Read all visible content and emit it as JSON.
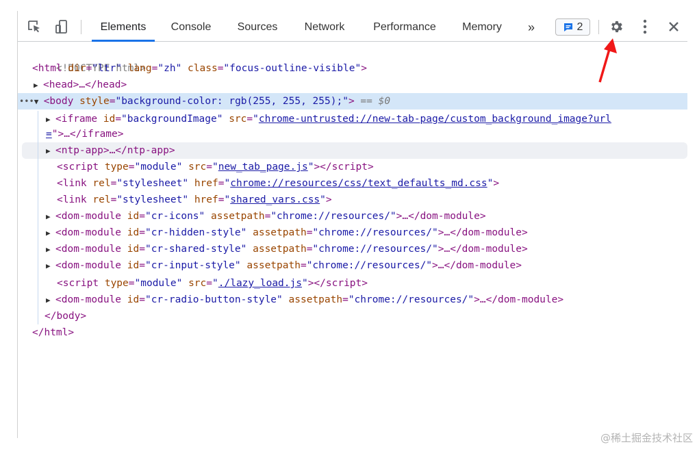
{
  "toolbar": {
    "inspect_icon": "inspect-element-icon",
    "device_icon": "device-toolbar-icon",
    "tabs": [
      {
        "label": "Elements",
        "active": true
      },
      {
        "label": "Console",
        "active": false
      },
      {
        "label": "Sources",
        "active": false
      },
      {
        "label": "Network",
        "active": false
      },
      {
        "label": "Performance",
        "active": false
      },
      {
        "label": "Memory",
        "active": false
      }
    ],
    "more_tabs": "»",
    "issues_count": "2",
    "settings_icon": "gear-icon",
    "menu_icon": "kebab-menu-icon",
    "close_icon": "close-icon"
  },
  "dom": {
    "doctype": "<!DOCTYPE html>",
    "html_open": {
      "tag": "<html",
      "attrs": [
        {
          "n": "dir",
          "v": "\"ltr\""
        },
        {
          "n": "lang",
          "v": "\"zh\""
        },
        {
          "n": "class",
          "v": "\"focus-outline-visible\""
        }
      ]
    },
    "head": "<head>…</head>",
    "body_open": {
      "tag": "<body",
      "attr": "style",
      "val": "\"background-color: rgb(255, 255, 255);\"",
      "eq": "== $0"
    },
    "iframe": {
      "tag": "<iframe",
      "id_attr": "id",
      "id_val": "\"backgroundImage\"",
      "src_attr": "src",
      "src_link_1": "chrome-untrusted://new-tab-page/custom_background_image?url",
      "src_link_2": "=",
      "tail": "\">…</iframe>"
    },
    "ntp_app": "<ntp-app>…</ntp-app>",
    "script1": {
      "type_val": "\"module\"",
      "src_link": "new_tab_page.js"
    },
    "link1": {
      "rel_val": "\"stylesheet\"",
      "href_link": "chrome://resources/css/text_defaults_md.css"
    },
    "link2": {
      "rel_val": "\"stylesheet\"",
      "href_link": "shared_vars.css"
    },
    "dom_modules": [
      {
        "id": "\"cr-icons\"",
        "path": "\"chrome://resources/\""
      },
      {
        "id": "\"cr-hidden-style\"",
        "path": "\"chrome://resources/\""
      },
      {
        "id": "\"cr-shared-style\"",
        "path": "\"chrome://resources/\""
      },
      {
        "id": "\"cr-input-style\"",
        "path": "\"chrome://resources/\""
      }
    ],
    "script2": {
      "type_val": "\"module\"",
      "src_link": "./lazy_load.js"
    },
    "dom_module_last": {
      "id": "\"cr-radio-button-style\"",
      "path": "\"chrome://resources/\""
    },
    "body_close": "</body>",
    "html_close": "</html>"
  },
  "watermark": "@稀土掘金技术社区",
  "colors": {
    "accent": "#1a73e8",
    "arrow": "#f01818"
  }
}
